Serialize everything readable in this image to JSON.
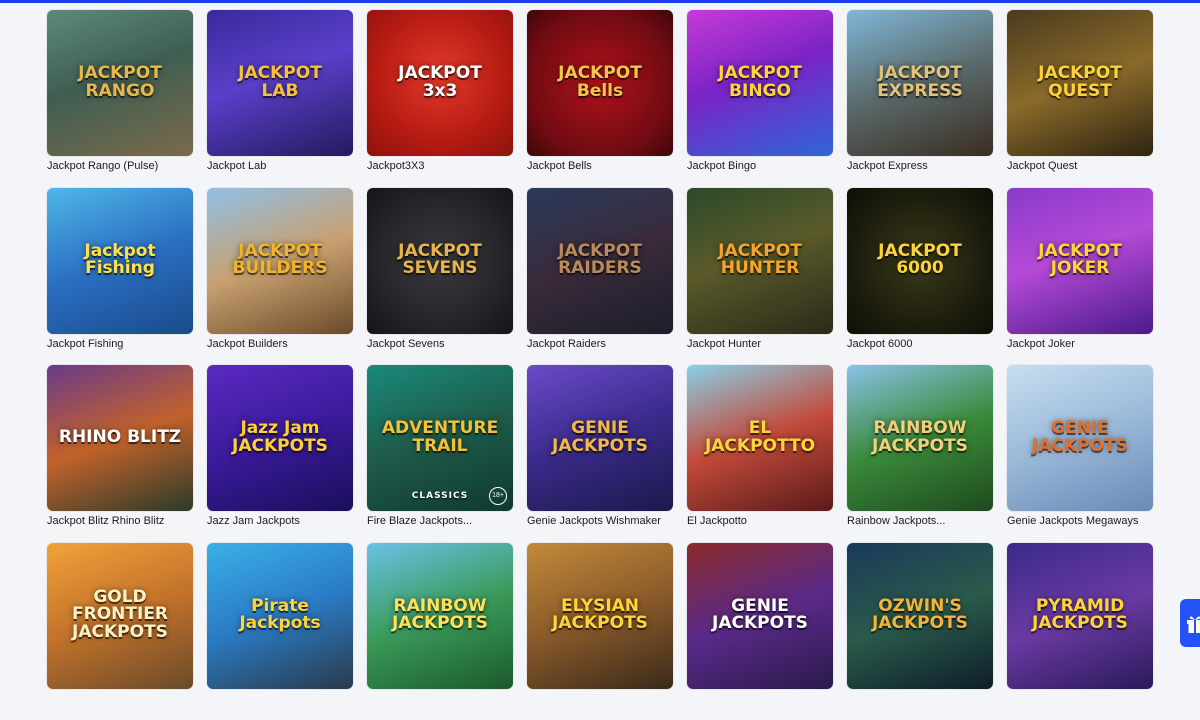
{
  "games": [
    {
      "label": "Jackpot Rango (Pulse)",
      "art": "JACKPOT\nRANGO",
      "bg": "linear-gradient(160deg,#5d8a7a 0%,#3f5e52 45%,#7a6a4a 100%)",
      "fg": "#e8b84a"
    },
    {
      "label": "Jackpot Lab",
      "art": "JACKPOT\nLAB",
      "bg": "linear-gradient(160deg,#3a2a9a 0%,#5a3fc9 45%,#241a5e 100%)",
      "fg": "#f7c238"
    },
    {
      "label": "Jackpot3X3",
      "art": "JACKPOT\n3x3",
      "bg": "radial-gradient(circle at 50% 45%,#e23a2a 0%,#b51b12 60%,#8c1209 100%)",
      "fg": "#ffffff"
    },
    {
      "label": "Jackpot Bells",
      "art": "JACKPOT\nBells",
      "bg": "radial-gradient(circle at 50% 50%,#b0121d 0%,#6f0b12 70%,#3f0509 100%)",
      "fg": "#f3c64a"
    },
    {
      "label": "Jackpot Bingo",
      "art": "JACKPOT\nBINGO",
      "bg": "linear-gradient(160deg,#c63bd6 0%,#7b23c5 45%,#2e66d8 100%)",
      "fg": "#ffd43a"
    },
    {
      "label": "Jackpot Express",
      "art": "JACKPOT\nEXPRESS",
      "bg": "linear-gradient(160deg,#7fb7d8 0%,#5a6a6a 50%,#3a2d22 100%)",
      "fg": "#e2c27a"
    },
    {
      "label": "Jackpot Quest",
      "art": "JACKPOT\nQUEST",
      "bg": "linear-gradient(160deg,#4a3a1e 0%,#8a6a2a 50%,#2e2410 100%)",
      "fg": "#ffd23a"
    },
    {
      "label": "Jackpot Fishing",
      "art": "Jackpot\nFishing",
      "bg": "linear-gradient(160deg,#4fb7e6 0%,#2a6fc2 50%,#1a4a8a 100%)",
      "fg": "#ffe14a"
    },
    {
      "label": "Jackpot Builders",
      "art": "JACKPOT\nBUILDERS",
      "bg": "linear-gradient(160deg,#8fc0e8 0%,#c8a070 50%,#6a4a2a 100%)",
      "fg": "#f2b42a"
    },
    {
      "label": "Jackpot Sevens",
      "art": "JACKPOT\nSEVENS",
      "bg": "radial-gradient(circle at 50% 50%,#3a3a3e 0%,#25252a 60%,#151518 100%)",
      "fg": "#e8b44a"
    },
    {
      "label": "Jackpot Raiders",
      "art": "JACKPOT\nRAIDERS",
      "bg": "linear-gradient(160deg,#2a3a5a 0%,#3a2a3a 50%,#1a1e2a 100%)",
      "fg": "#b98a5a"
    },
    {
      "label": "Jackpot Hunter",
      "art": "JACKPOT\nHUNTER",
      "bg": "linear-gradient(160deg,#2a4a2a 0%,#5a5a2a 45%,#2a2a1a 100%)",
      "fg": "#f4a52a"
    },
    {
      "label": "Jackpot 6000",
      "art": "JACKPOT\n6000",
      "bg": "radial-gradient(circle at 50% 50%,#3a3a18 0%,#1e1e0e 60%,#0e0e06 100%)",
      "fg": "#ffd43a"
    },
    {
      "label": "Jackpot Joker",
      "art": "JACKPOT\nJOKER",
      "bg": "linear-gradient(160deg,#8a3ac9 0%,#b54ad8 45%,#4a1a8a 100%)",
      "fg": "#ffd43a"
    },
    {
      "label": "Jackpot Blitz Rhino Blitz",
      "art": "RHINO BLITZ",
      "bg": "linear-gradient(160deg,#6a3a8a 0%,#c2622a 50%,#2a3a2a 100%)",
      "fg": "#ffffff"
    },
    {
      "label": "Jazz Jam Jackpots",
      "art": "Jazz Jam\nJACKPOTS",
      "bg": "linear-gradient(160deg,#5a2ac2 0%,#3a1a9a 50%,#1a0e5a 100%)",
      "fg": "#ffcf3a"
    },
    {
      "label": "Fire Blaze Jackpots...",
      "art": "ADVENTURE\nTRAIL",
      "sub": "CLASSICS",
      "age": "18+",
      "bg": "linear-gradient(160deg,#1a8a7a 0%,#1e5a4a 50%,#0e3a2e 100%)",
      "fg": "#f2c23a"
    },
    {
      "label": "Genie Jackpots Wishmaker",
      "art": "GENIE\nJACKPOTS",
      "bg": "linear-gradient(160deg,#6a4ac9 0%,#3a2a8a 50%,#1a1a4a 100%)",
      "fg": "#f4b84a"
    },
    {
      "label": "El Jackpotto",
      "art": "EL JACKPOTTO",
      "bg": "linear-gradient(160deg,#8ad0e8 0%,#c24a3a 50%,#5a1a1a 100%)",
      "fg": "#ffd43a"
    },
    {
      "label": "Rainbow Jackpots...",
      "art": "RAINBOW\nJACKPOTS",
      "bg": "linear-gradient(160deg,#8ac2e8 0%,#3a8a3a 50%,#1e4a1e 100%)",
      "fg": "#f4d07a"
    },
    {
      "label": "Genie Jackpots Megaways",
      "art": "GENIE\nJACKPOTS",
      "bg": "linear-gradient(160deg,#c8dff0 0%,#9ab8d8 50%,#6a8ab8 100%)",
      "fg": "#e2702a"
    },
    {
      "label": "",
      "art": "GOLD FRONTIER\nJACKPOTS",
      "bg": "linear-gradient(160deg,#f2a23a 0%,#c2722a 50%,#6a4a2a 100%)",
      "fg": "#fff2c2"
    },
    {
      "label": "",
      "art": "Pirate\nJackpots",
      "bg": "linear-gradient(160deg,#3ab0e8 0%,#2a7ac2 50%,#2a3a4a 100%)",
      "fg": "#ffd43a"
    },
    {
      "label": "",
      "art": "RAINBOW\nJACKPOTS",
      "bg": "linear-gradient(160deg,#6ac2e8 0%,#3a9a5a 50%,#1a5a2a 100%)",
      "fg": "#ffe25a"
    },
    {
      "label": "",
      "art": "ELYSIAN\nJACKPOTS",
      "bg": "linear-gradient(160deg,#c28a3a 0%,#8a5a2a 50%,#3a2a1a 100%)",
      "fg": "#ffd43a"
    },
    {
      "label": "",
      "art": "GENIE JACKPOTS",
      "bg": "linear-gradient(160deg,#8a2a2a 0%,#5a2a8a 50%,#2a1a4a 100%)",
      "fg": "#ffffff"
    },
    {
      "label": "",
      "art": "OZWIN'S\nJACKPOTS",
      "bg": "linear-gradient(160deg,#1a3a5a 0%,#2a5a4a 50%,#0e1e2a 100%)",
      "fg": "#f4b43a"
    },
    {
      "label": "",
      "art": "PYRAMID\nJACKPOTS",
      "bg": "linear-gradient(160deg,#3a2a8a 0%,#6a3aa2 50%,#2a1a5a 100%)",
      "fg": "#ffd43a"
    }
  ],
  "gift_button": {
    "icon": "gift-icon"
  }
}
